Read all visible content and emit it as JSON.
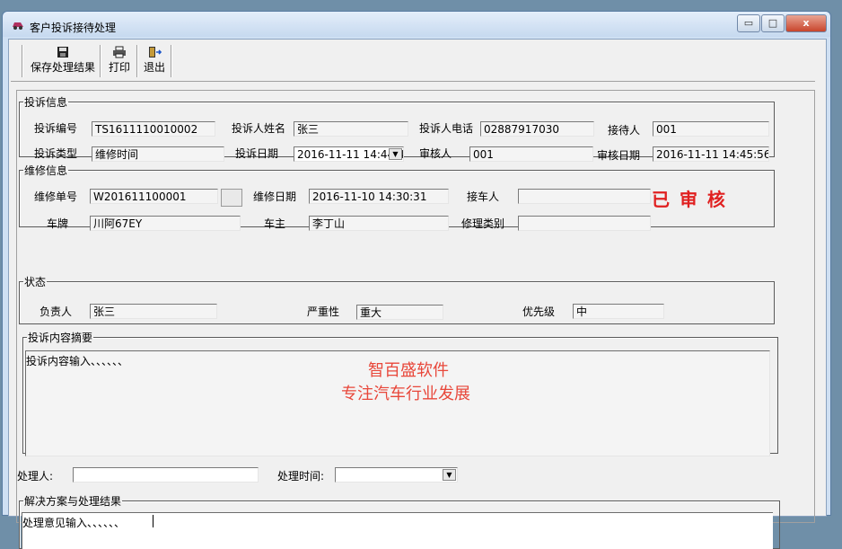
{
  "window": {
    "title": "客户投诉接待处理",
    "minimize_glyph": "▭",
    "maximize_glyph": "□",
    "close_glyph": "x"
  },
  "toolbar": {
    "save_label": "保存处理结果",
    "print_label": "打印",
    "exit_label": "退出"
  },
  "complaint_info": {
    "legend": "投诉信息",
    "no_label": "投诉编号",
    "no_value": "TS1611110010002",
    "name_label": "投诉人姓名",
    "name_value": "张三",
    "phone_label": "投诉人电话",
    "phone_value": "02887917030",
    "receiver_label": "接待人",
    "receiver_value": "001",
    "type_label": "投诉类型",
    "type_value": "维修时间",
    "date_label": "投诉日期",
    "date_value": "2016-11-11 14:44:4",
    "reviewer_label": "审核人",
    "reviewer_value": "001",
    "review_date_label": "审核日期",
    "review_date_value": "2016-11-11 14:45:56"
  },
  "repair_info": {
    "legend": "维修信息",
    "order_label": "维修单号",
    "order_value": "W201611100001",
    "repair_date_label": "维修日期",
    "repair_date_value": "2016-11-10 14:30:31",
    "pickup_label": "接车人",
    "pickup_value": "",
    "plate_label": "车牌",
    "plate_value": "川阿67EY",
    "owner_label": "车主",
    "owner_value": "李丁山",
    "category_label": "修理类别",
    "category_value": "",
    "approved_stamp": "已 审 核"
  },
  "status": {
    "legend": "状态",
    "owner_label": "负责人",
    "owner_value": "张三",
    "severity_label": "严重性",
    "severity_value": "重大",
    "priority_label": "优先级",
    "priority_value": "中"
  },
  "summary": {
    "legend": "投诉内容摘要",
    "text": "投诉内容输入、、、、、、",
    "watermark_line1": "智百盛软件",
    "watermark_line2": "专注汽车行业发展"
  },
  "handling": {
    "handler_label": "处理人:",
    "handler_value": "",
    "time_label": "处理时间:",
    "time_value": ""
  },
  "solution": {
    "legend": "解决方案与处理结果",
    "text": "处理意见输入、、、、、、"
  },
  "colors": {
    "stamp": "#e02020",
    "watermark": "#e8473a"
  }
}
